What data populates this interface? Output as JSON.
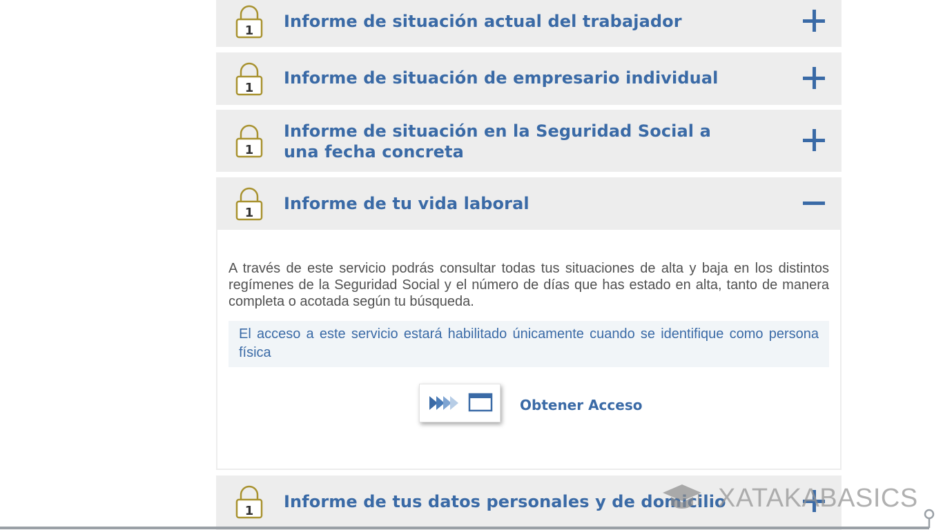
{
  "accordion": {
    "items": [
      {
        "title": "Informe de situación actual del trabajador",
        "lock_number": "1",
        "state": "collapsed"
      },
      {
        "title": "Informe de situación de empresario individual",
        "lock_number": "1",
        "state": "collapsed"
      },
      {
        "title": "Informe de situación en la Seguridad Social a una fecha concreta",
        "lock_number": "1",
        "state": "collapsed"
      },
      {
        "title": "Informe de tu vida laboral",
        "lock_number": "1",
        "state": "expanded"
      },
      {
        "title": "Informe de tus datos personales y de domicilio",
        "lock_number": "1",
        "state": "collapsed"
      }
    ],
    "expanded_panel": {
      "description": "A través de este servicio podrás consultar todas tus situaciones de alta y baja en los distintos regímenes de la Seguridad Social y el número de días que has estado en alta, tanto de manera completa o acotada según tu búsqueda.",
      "notice": "El acceso a este servicio estará habilitado únicamente cuando se identifique como persona física",
      "access_label": "Obtener Acceso"
    }
  },
  "icons": {
    "lock": "lock-icon",
    "expand": "plus-icon",
    "collapse": "minus-icon",
    "access": "forward-window-icon"
  },
  "watermark": {
    "text": "XATAKABASICS",
    "icon": "graduation-cap-icon"
  },
  "colors": {
    "title_blue": "#3a6aa6",
    "lock_gold": "#a8922f",
    "header_bg": "#ededed",
    "notice_bg": "#f1f5f8",
    "body_text": "#505050"
  }
}
